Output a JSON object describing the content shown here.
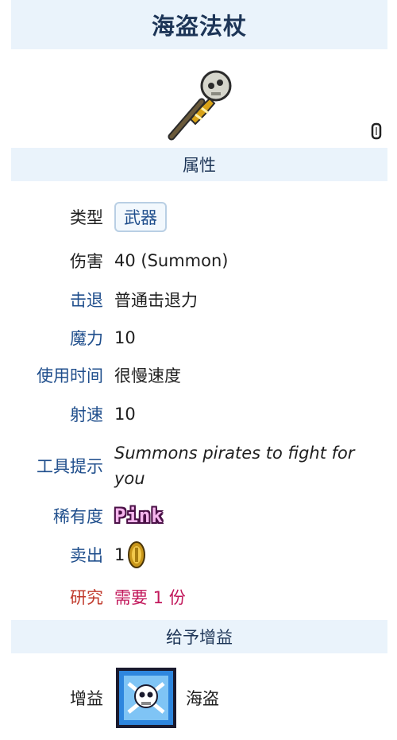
{
  "title": "海盗法杖",
  "sections": {
    "properties": "属性",
    "buff": "给予增益"
  },
  "rows": {
    "type": {
      "label": "类型",
      "value": "武器"
    },
    "damage": {
      "label": "伤害",
      "value": "40 (Summon)"
    },
    "knockback": {
      "label": "击退",
      "value": "普通击退力"
    },
    "mana": {
      "label": "魔力",
      "value": "10"
    },
    "use_time": {
      "label": "使用时间",
      "value": "很慢速度"
    },
    "velocity": {
      "label": "射速",
      "value": "10"
    },
    "tooltip": {
      "label": "工具提示",
      "value": "Summons pirates to fight for you"
    },
    "rarity": {
      "label": "稀有度",
      "value": "Pink"
    },
    "sell": {
      "label": "卖出",
      "value": "1"
    },
    "research": {
      "label": "研究",
      "value": "需要 1 份"
    },
    "buff": {
      "label": "增益",
      "value": "海盗"
    }
  },
  "icons": {
    "item": "pirate-staff-icon",
    "small": "autoswing-icon",
    "coin": "gold-coin-icon",
    "buff": "pirates-buff-icon"
  },
  "colors": {
    "header_bg": "#eaf3fb",
    "link": "#1f4e8c",
    "research_label": "#c0392b",
    "research_value": "#c2185b",
    "rarity_fill": "#f6b6ee"
  }
}
